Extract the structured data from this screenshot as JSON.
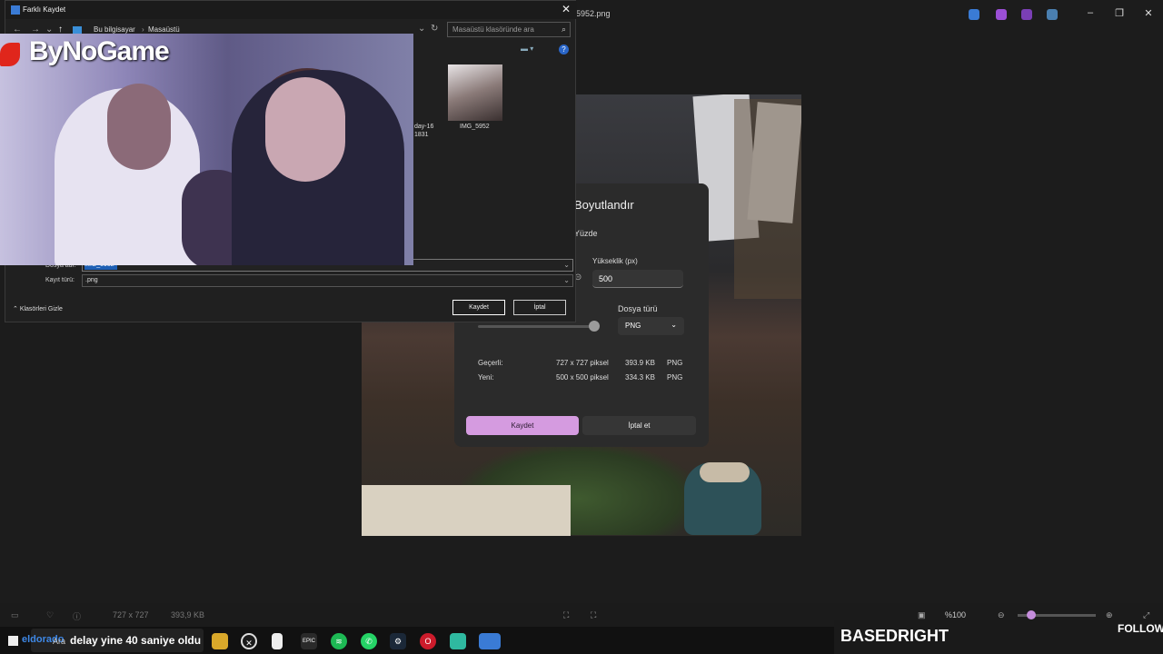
{
  "viewer": {
    "title_fragment": "5952.png",
    "status": {
      "dimensions": "727 x 727",
      "size": "393,9 KB",
      "zoom": "%100"
    }
  },
  "resize_dialog": {
    "title": "Boyutlandır",
    "mode": "Yüzde",
    "height_label": "Yükseklik (px)",
    "height_value": "500",
    "file_type_label": "Dosya türü",
    "file_type_value": "PNG",
    "current_label": "Geçerli:",
    "current_dims": "727 x 727 piksel",
    "current_size": "393.9 KB",
    "current_format": "PNG",
    "new_label": "Yeni:",
    "new_dims": "500 x 500 piksel",
    "new_size": "334.3 KB",
    "new_format": "PNG",
    "save_button": "Kaydet",
    "cancel_button": "İptal et"
  },
  "save_dialog": {
    "title": "Farklı Kaydet",
    "breadcrumb": [
      "Bu bilgisayar",
      "Masaüstü"
    ],
    "search_placeholder": "Masaüstü klasöründe ara",
    "files": [
      {
        "name": "IMG_5952"
      },
      {
        "name": "day-16\n1831"
      }
    ],
    "file_name_label": "Dosya adı:",
    "file_name_value": "IMG_5952",
    "save_type_label": "Kayıt türü:",
    "save_type_value": ".png",
    "hide_folders": "Klasörleri Gizle",
    "save_button": "Kaydet",
    "cancel_button": "İptal"
  },
  "overlay": {
    "brand": "ByNoGame",
    "ticker_site": "eldorado",
    "ticker_text": "delay yine 40 saniye oldu",
    "streamer": "BASEDRIGHT",
    "follow": "FOLLOW",
    "search_taskbar": "Ara"
  },
  "colors": {
    "accent": "#d59be0",
    "dialog_bg": "#2b2b2b",
    "link_blue": "#1e5fb4"
  }
}
